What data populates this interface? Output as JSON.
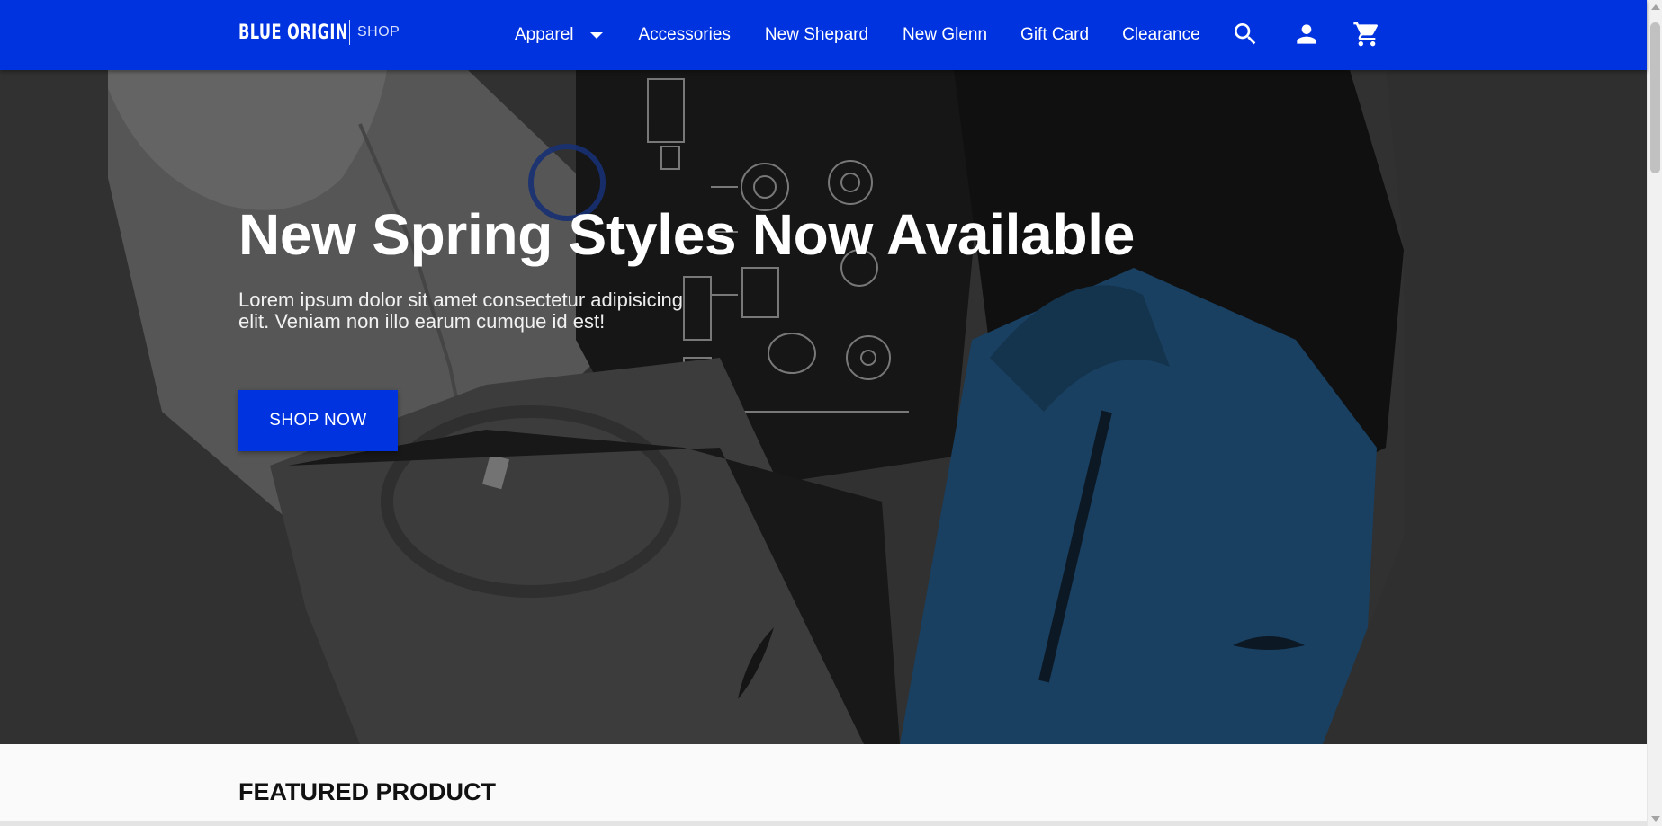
{
  "nav": {
    "brand_main": "BLUE ORIGIN",
    "brand_sub": "SHOP",
    "items": [
      {
        "label": "Apparel",
        "has_dropdown": true
      },
      {
        "label": "Accessories"
      },
      {
        "label": "New Shepard"
      },
      {
        "label": "New Glenn"
      },
      {
        "label": "Gift Card"
      },
      {
        "label": "Clearance"
      }
    ],
    "icons": [
      "search-icon",
      "account-icon",
      "cart-icon"
    ],
    "background_color": "#0033e0"
  },
  "hero": {
    "title": "New Spring Styles Now Available",
    "text": "Lorem ipsum dolor sit amet consectetur adipisicing elit. Veniam non illo earum cumque id est!",
    "button_label": "SHOP NOW",
    "button_color": "#0033e0"
  },
  "featured": {
    "title": "FEATURED PRODUCT"
  }
}
